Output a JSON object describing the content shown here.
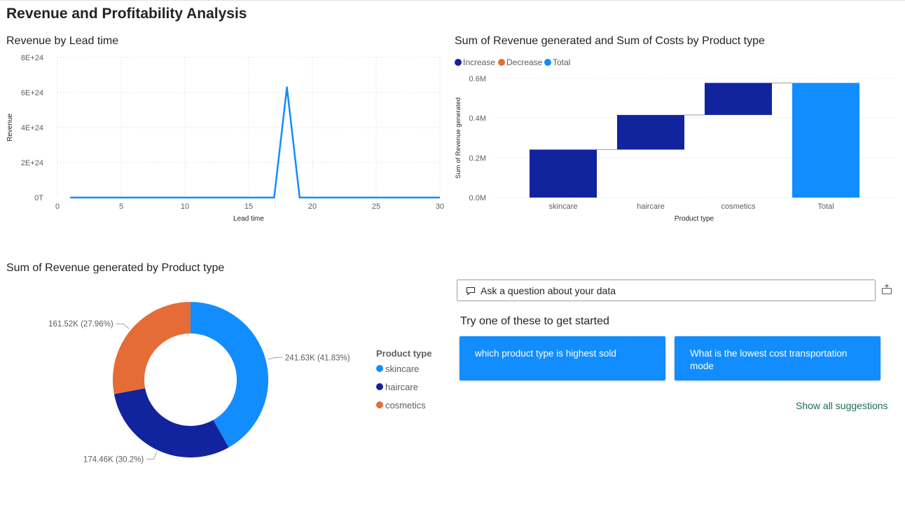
{
  "page": {
    "title": "Revenue and Profitability Analysis"
  },
  "colors": {
    "accent_light_blue": "#118dff",
    "dark_blue": "#12239e",
    "orange": "#e66c37",
    "link_green": "#1e6b5c"
  },
  "chart_data": [
    {
      "type": "line",
      "title": "Revenue by Lead time",
      "xlabel": "Lead time",
      "ylabel": "Revenue",
      "x_ticks": [
        "0",
        "5",
        "10",
        "15",
        "20",
        "25",
        "30"
      ],
      "y_ticks": [
        "0T",
        "2E+24",
        "4E+24",
        "6E+24",
        "8E+24"
      ],
      "xlim": [
        0,
        30
      ],
      "ylim": [
        0,
        8e+24
      ],
      "grid": true,
      "series": [
        {
          "color": "#118dff",
          "x": [
            1,
            17,
            18,
            19,
            30
          ],
          "y": [
            0,
            0,
            6.3e+24,
            0,
            0
          ]
        }
      ]
    },
    {
      "type": "bar",
      "subtype": "waterfall",
      "title": "Sum of Revenue generated and Sum of Costs by Product type",
      "xlabel": "Product type",
      "ylabel": "Sum of Revenue generated",
      "legend": {
        "position": "top-left",
        "items": [
          {
            "name": "Increase",
            "color": "#12239e"
          },
          {
            "name": "Decrease",
            "color": "#e66c37"
          },
          {
            "name": "Total",
            "color": "#118dff"
          }
        ]
      },
      "categories": [
        "skincare",
        "haircare",
        "cosmetics",
        "Total"
      ],
      "bars": [
        {
          "start": 0,
          "end": 241630,
          "kind": "increase"
        },
        {
          "start": 241630,
          "end": 416090,
          "kind": "increase"
        },
        {
          "start": 416090,
          "end": 577610,
          "kind": "increase"
        },
        {
          "start": 0,
          "end": 577610,
          "kind": "total"
        }
      ],
      "y_ticks": [
        "0.0M",
        "0.2M",
        "0.4M",
        "0.6M"
      ],
      "ylim": [
        0,
        0.6
      ],
      "grid": true
    },
    {
      "type": "pie",
      "subtype": "donut",
      "title": "Sum of Revenue generated by Product type",
      "legend": {
        "title": "Product type",
        "position": "right"
      },
      "slices": [
        {
          "name": "skincare",
          "value": 241630,
          "label": "241.63K (41.83%)",
          "color": "#118dff"
        },
        {
          "name": "haircare",
          "value": 174460,
          "label": "174.46K (30.2%)",
          "color": "#12239e"
        },
        {
          "name": "cosmetics",
          "value": 161520,
          "label": "161.52K (27.96%)",
          "color": "#e66c37"
        }
      ]
    }
  ],
  "qa": {
    "placeholder": "Ask a question about your data",
    "prompt": "Try one of these to get started",
    "suggestions": [
      "which product type is highest sold",
      "What is the lowest cost transportation mode"
    ],
    "show_all": "Show all suggestions"
  }
}
